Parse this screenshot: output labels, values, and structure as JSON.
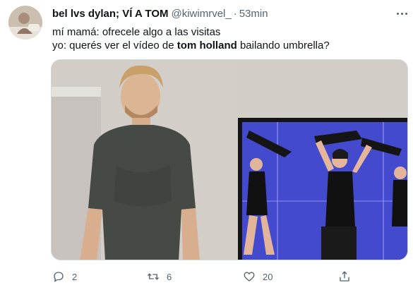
{
  "tweet": {
    "author_name": "bel lvs dylan; VÍ A TOM",
    "handle": "@kiwimrvel_",
    "separator": "·",
    "time": "53min",
    "line1": "mí mamá: ofrecele algo a las visitas",
    "line2_prefix": "yo: querés ver el vídeo de ",
    "line2_bold": "tom holland",
    "line2_suffix": " bailando umbrella?",
    "replies": "2",
    "retweets": "6",
    "likes": "20"
  },
  "colors": {
    "text": "#0f1419",
    "muted": "#536471",
    "border": "#cfd9de"
  },
  "icons": [
    "reply-icon",
    "retweet-icon",
    "like-icon",
    "share-icon",
    "more-icon"
  ]
}
